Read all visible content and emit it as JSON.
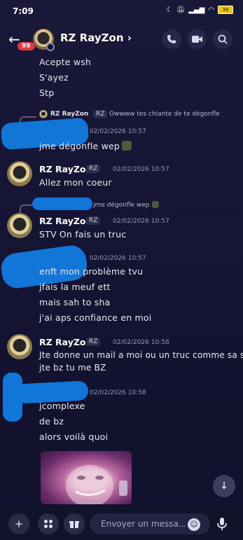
{
  "status_bar": {
    "time": "7:09",
    "battery": "38"
  },
  "header": {
    "title": "RZ RayZon",
    "chevron": "›",
    "unread_badge": "99",
    "back_icon": "arrow-left",
    "call_icon": "phone",
    "video_icon": "video",
    "search_icon": "magnifier"
  },
  "messages": {
    "block0": {
      "lines": [
        "Acepte wsh",
        "S'ayez",
        "Stp"
      ]
    },
    "block1": {
      "reply_author": "RZ RayZon",
      "reply_tag": "RZ",
      "reply_text": "Owwww tes chiante de te dégonfle",
      "timestamp": "02/02/2026 10:57",
      "line": "jme dégonfle wep"
    },
    "block2": {
      "author": "RZ RayZon",
      "tag": "RZ",
      "timestamp": "02/02/2026 10:57",
      "line": "Allez mon coeur"
    },
    "block3": {
      "reply_text": "jme dégonfle wep",
      "author": "RZ RayZon",
      "tag": "RZ",
      "timestamp": "02/02/2026 10:57",
      "line": "STV On fais un truc"
    },
    "block4": {
      "timestamp": "02/02/2026 10:57",
      "lines": [
        "enft mon problème tvu",
        "jfais la meuf ett",
        "mais sah to sha",
        "j'ai aps confiance en moi"
      ]
    },
    "block5": {
      "author": "RZ RayZon",
      "tag": "RZ",
      "timestamp": "02/02/2026 10:58",
      "lines": [
        "Jte donne un mail a moi ou un truc comme sa si",
        "jte bz tu me BZ"
      ]
    },
    "block6": {
      "timestamp": "02/02/2026 10:58",
      "lines": [
        "jcomplexe",
        "de bz",
        "alors voilà quoi"
      ]
    }
  },
  "composer": {
    "placeholder": "Envoyer un messa...",
    "plus_icon": "+",
    "apps_icon": "apps",
    "gift_icon": "gift",
    "emoji_icon": "smiley",
    "mic_icon": "microphone"
  },
  "scroll_down_icon": "↓",
  "colors": {
    "background": "#14142e",
    "redaction": "#1276d8",
    "badge": "#e0393e"
  }
}
